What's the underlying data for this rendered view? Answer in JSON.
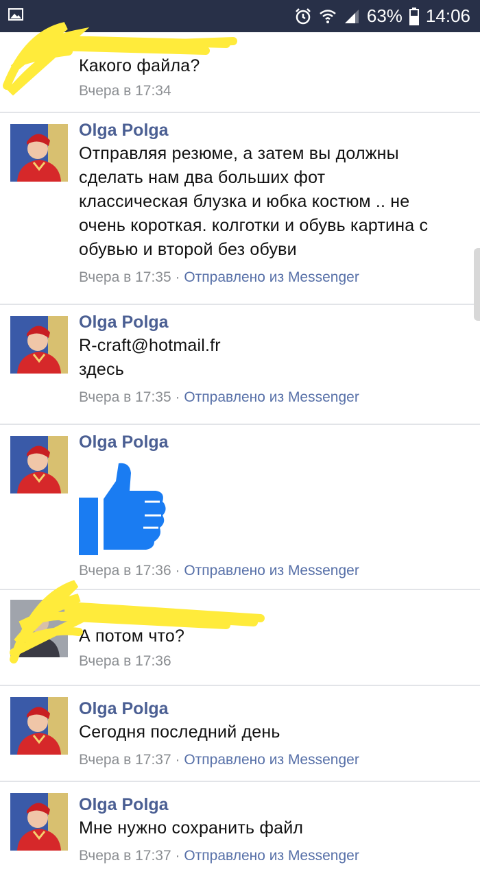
{
  "status": {
    "battery": "63%",
    "time": "14:06",
    "icons": [
      "image-icon",
      "alarm-icon",
      "wifi-icon",
      "signal-icon",
      "battery-icon"
    ]
  },
  "colors": {
    "author": "#4b5f93",
    "via": "#5770a8",
    "statusbar": "#283048",
    "scribble": "#ffeb3b",
    "like": "#1a7cf2"
  },
  "messages": [
    {
      "author": "",
      "text": "Какого файла?",
      "time": "Вчера в 17:34",
      "via": ""
    },
    {
      "author": "Olga Polga",
      "text": "Отправляя резюме, а затем вы должны\nсделать нам два больших фот\nклассическая блузка и юбка костюм .. не\nочень короткая. колготки и обувь картина с\nобувью и второй без обуви",
      "time": "Вчера в 17:35",
      "via": "Отправлено из Messenger"
    },
    {
      "author": "Olga Polga",
      "text": "R-craft@hotmail.fr\nздесь",
      "time": "Вчера в 17:35",
      "via": "Отправлено из Messenger"
    },
    {
      "author": "Olga Polga",
      "text": "",
      "time": "Вчера в 17:36",
      "via": "Отправлено из Messenger",
      "sticker": "thumbs-up-icon"
    },
    {
      "author": "",
      "text": "А потом что?",
      "time": "Вчера в 17:36",
      "via": ""
    },
    {
      "author": "Olga Polga",
      "text": "Сегодня последний день",
      "time": "Вчера в 17:37",
      "via": "Отправлено из Messenger"
    },
    {
      "author": "Olga Polga",
      "text": "Мне нужно сохранить файл",
      "time": "Вчера в 17:37",
      "via": "Отправлено из Messenger"
    }
  ],
  "sep": " · "
}
